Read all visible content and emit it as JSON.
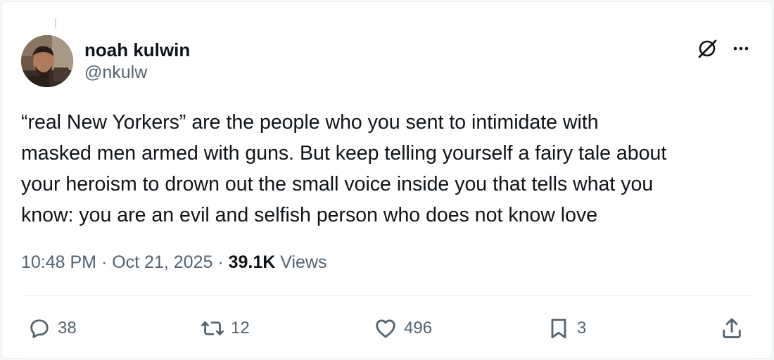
{
  "author": {
    "display_name": "noah kulwin",
    "handle": "@nkulw",
    "avatar_icon": "profile-photo"
  },
  "header_actions": {
    "grok_icon": "grok-icon",
    "more_icon": "more-dots-icon",
    "more_label": "···"
  },
  "tweet": {
    "text": "“real New Yorkers” are the people who you sent to intimidate with\nmasked men armed with guns. But keep telling yourself a fairy tale about\nyour heroism to drown out the small voice inside you that tells what you\nknow: you are an evil and selfish person who does not know love"
  },
  "meta": {
    "time": "10:48 PM",
    "separator": " · ",
    "date": "Oct 21, 2025",
    "views_count": "39.1K",
    "views_label": "Views"
  },
  "actions": {
    "replies": "38",
    "reposts": "12",
    "likes": "496",
    "bookmarks": "3"
  },
  "colors": {
    "text_primary": "#0f1419",
    "text_secondary": "#536471",
    "divider": "#eff3f4",
    "background": "#ffffff"
  }
}
